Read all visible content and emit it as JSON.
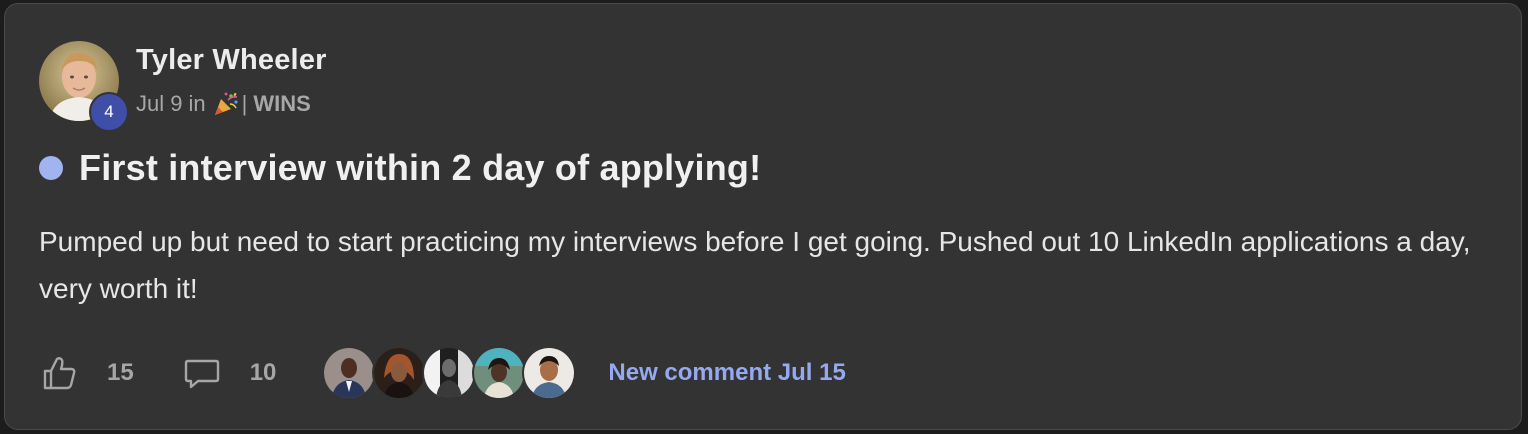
{
  "post": {
    "author": "Tyler Wheeler",
    "level": "4",
    "date": "Jul 9",
    "in_label": "in",
    "category_icon": "party-popper-icon",
    "separator": "|",
    "category": "WINS",
    "title": "First interview within 2 day of applying!",
    "body": "Pumped up but need to start practicing my interviews before I get going. Pushed out 10 LinkedIn applications a day, very worth it!",
    "likes": "15",
    "comments": "10",
    "last_comment": "New comment Jul 15"
  },
  "colors": {
    "card_bg": "#333333",
    "unread_dot": "#a2b4ef",
    "level_badge": "#3f4ea7",
    "link": "#94a9ef",
    "muted": "#a6a6a6"
  },
  "icons": {
    "like": "thumbs-up-icon",
    "comment": "speech-bubble-icon"
  },
  "commenter_avatars": [
    "commenter-avatar-1",
    "commenter-avatar-2",
    "commenter-avatar-3",
    "commenter-avatar-4",
    "commenter-avatar-5"
  ]
}
